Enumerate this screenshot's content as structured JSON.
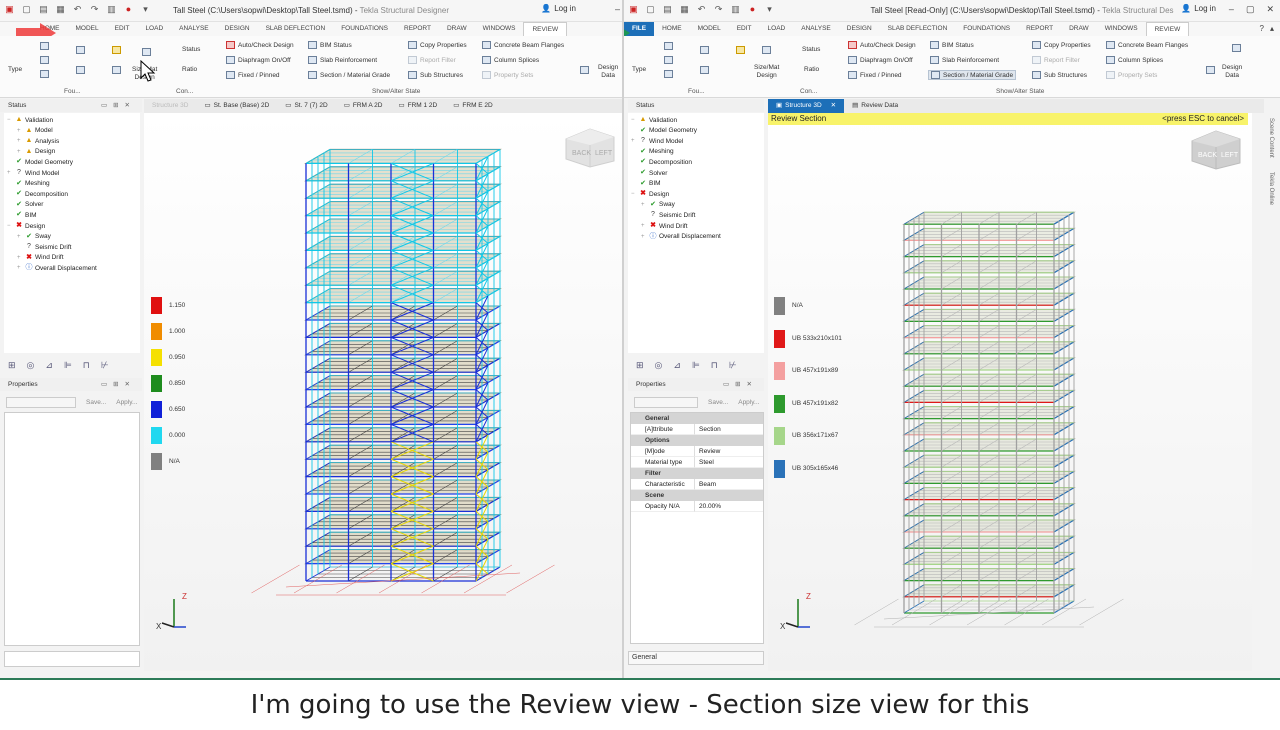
{
  "left": {
    "title": "Tall Steel (C:\\Users\\sopwi\\Desktop\\Tall Steel.tsmd)",
    "app_name": "Tekla Structural Designer",
    "login": "Log in",
    "tabs": [
      "HOME",
      "MODEL",
      "EDIT",
      "LOAD",
      "ANALYSE",
      "DESIGN",
      "SLAB DEFLECTION",
      "FOUNDATIONS",
      "REPORT",
      "DRAW",
      "WINDOWS",
      "REVIEW"
    ],
    "ribbon": {
      "type": "Type",
      "status_btn": "Status",
      "ratio_btn": "Ratio",
      "sizemat": "Size/Mat",
      "sizemat2": "Design",
      "design_data": "Design",
      "design_data2": "Data",
      "auto_check": "Auto/Check Design",
      "diaphragm": "Diaphragm On/Off",
      "fixed": "Fixed / Pinned",
      "bim": "BIM Status",
      "slab_reinf": "Slab Reinforcement",
      "section_grade": "Section / Material Grade",
      "copy_props": "Copy Properties",
      "report_filter": "Report Filter",
      "sub_structures": "Sub Structures",
      "conc_flanges": "Concrete Beam Flanges",
      "col_splices": "Column Splices",
      "prop_sets": "Property Sets",
      "group_fou": "Fou...",
      "group_con": "Con...",
      "group_show": "Show/Alter State"
    },
    "status_panel": "Status",
    "tree": [
      {
        "label": "Validation",
        "status": "warn",
        "indent": 0,
        "exp": "−"
      },
      {
        "label": "Model",
        "status": "warn",
        "indent": 1,
        "exp": "+"
      },
      {
        "label": "Analysis",
        "status": "warn",
        "indent": 1,
        "exp": "+"
      },
      {
        "label": "Design",
        "status": "warn",
        "indent": 1,
        "exp": "+"
      },
      {
        "label": "Model Geometry",
        "status": "ok",
        "indent": 0,
        "exp": ""
      },
      {
        "label": "Wind Model",
        "status": "q",
        "indent": 0,
        "exp": "+"
      },
      {
        "label": "Meshing",
        "status": "ok",
        "indent": 0,
        "exp": ""
      },
      {
        "label": "Decomposition",
        "status": "ok",
        "indent": 0,
        "exp": ""
      },
      {
        "label": "Solver",
        "status": "ok",
        "indent": 0,
        "exp": ""
      },
      {
        "label": "BIM",
        "status": "ok",
        "indent": 0,
        "exp": ""
      },
      {
        "label": "Design",
        "status": "err",
        "indent": 0,
        "exp": "−"
      },
      {
        "label": "Sway",
        "status": "ok",
        "indent": 1,
        "exp": "+"
      },
      {
        "label": "Seismic Drift",
        "status": "q",
        "indent": 1,
        "exp": ""
      },
      {
        "label": "Wind Drift",
        "status": "err",
        "indent": 1,
        "exp": "+"
      },
      {
        "label": "Overall Displacement",
        "status": "inf",
        "indent": 1,
        "exp": "+"
      }
    ],
    "properties_panel": "Properties",
    "save": "Save...",
    "apply": "Apply...",
    "view_tabs": [
      "Structure 3D",
      "St. Base (Base) 2D",
      "St. 7 (7) 2D",
      "FRM A 2D",
      "FRM 1 2D",
      "FRM E 2D"
    ],
    "navcube_back": "BACK",
    "navcube_left": "LEFT",
    "legend": [
      {
        "label": "1.150",
        "color": "#e01010"
      },
      {
        "label": "1.000",
        "color": "#f08c00"
      },
      {
        "label": "0.950",
        "color": "#f5e000"
      },
      {
        "label": "0.850",
        "color": "#1e8c1e"
      },
      {
        "label": "0.650",
        "color": "#1020d8"
      },
      {
        "label": "0.000",
        "color": "#20d8f0"
      },
      {
        "label": "N/A",
        "color": "#808080"
      }
    ]
  },
  "right": {
    "title": "Tall Steel [Read-Only] (C:\\Users\\sopwi\\Desktop\\Tall Steel.tsmd)",
    "app_name": "Tekla Structural Des",
    "login": "Log in",
    "tabs": [
      "FILE",
      "HOME",
      "MODEL",
      "EDIT",
      "LOAD",
      "ANALYSE",
      "DESIGN",
      "SLAB DEFLECTION",
      "FOUNDATIONS",
      "REPORT",
      "DRAW",
      "WINDOWS",
      "REVIEW"
    ],
    "status_panel": "Status",
    "tree": [
      {
        "label": "Validation",
        "status": "warn",
        "indent": 0,
        "exp": "−"
      },
      {
        "label": "Model Geometry",
        "status": "ok",
        "indent": 0,
        "exp": ""
      },
      {
        "label": "Wind Model",
        "status": "q",
        "indent": 0,
        "exp": "+"
      },
      {
        "label": "Meshing",
        "status": "ok",
        "indent": 0,
        "exp": ""
      },
      {
        "label": "Decomposition",
        "status": "ok",
        "indent": 0,
        "exp": ""
      },
      {
        "label": "Solver",
        "status": "ok",
        "indent": 0,
        "exp": ""
      },
      {
        "label": "BIM",
        "status": "ok",
        "indent": 0,
        "exp": ""
      },
      {
        "label": "Design",
        "status": "err",
        "indent": 0,
        "exp": "−"
      },
      {
        "label": "Sway",
        "status": "ok",
        "indent": 1,
        "exp": "+"
      },
      {
        "label": "Seismic Drift",
        "status": "q",
        "indent": 1,
        "exp": ""
      },
      {
        "label": "Wind Drift",
        "status": "err",
        "indent": 1,
        "exp": "+"
      },
      {
        "label": "Overall Displacement",
        "status": "inf",
        "indent": 1,
        "exp": "+"
      }
    ],
    "properties_panel": "Properties",
    "save": "Save...",
    "apply": "Apply...",
    "props": {
      "general": "General",
      "attribute_k": "[A]ttribute",
      "attribute_v": "Section",
      "options": "Options",
      "mode_k": "[M]ode",
      "mode_v": "Review",
      "mattype_k": "Material type",
      "mattype_v": "Steel",
      "filter": "Filter",
      "char_k": "Characteristic",
      "char_v": "Beam",
      "scene": "Scene",
      "opacity_k": "Opacity N/A",
      "opacity_v": "20.00%"
    },
    "bottom_label": "General",
    "view_tabs": [
      "Structure 3D",
      "Review Data"
    ],
    "review_title": "Review Section",
    "review_esc": "<press ESC to cancel>",
    "navcube_back": "BACK",
    "navcube_left": "LEFT",
    "legend": [
      {
        "label": "N/A",
        "color": "#808080"
      },
      {
        "label": "UB 533x210x101",
        "color": "#e01818"
      },
      {
        "label": "UB 457x191x89",
        "color": "#f4a0a0"
      },
      {
        "label": "UB 457x191x82",
        "color": "#2e9a2e"
      },
      {
        "label": "UB 356x171x67",
        "color": "#a6d68a"
      },
      {
        "label": "UB 305x165x46",
        "color": "#2a72b8"
      }
    ],
    "side_tabs": [
      "Scene Content",
      "Tekla Online"
    ]
  },
  "caption": "I'm going to use the Review view - Section size view for this"
}
